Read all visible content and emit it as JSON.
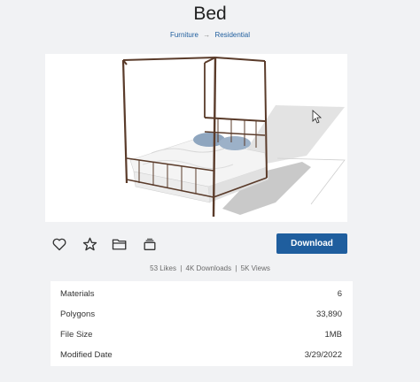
{
  "title": "Bed",
  "breadcrumb": {
    "category": "Furniture",
    "subcategory": "Residential"
  },
  "actions": {
    "download_label": "Download"
  },
  "stats": {
    "likes": "53 Likes",
    "downloads": "4K Downloads",
    "views": "5K Views",
    "separator": "|"
  },
  "details": [
    {
      "label": "Materials",
      "value": "6"
    },
    {
      "label": "Polygons",
      "value": "33,890"
    },
    {
      "label": "File Size",
      "value": "1MB"
    },
    {
      "label": "Modified Date",
      "value": "3/29/2022"
    }
  ],
  "colors": {
    "accent": "#1f5e9e",
    "background": "#f1f2f4"
  },
  "icons": [
    "heart-icon",
    "star-icon",
    "folder-icon",
    "collection-icon",
    "cursor-icon"
  ]
}
